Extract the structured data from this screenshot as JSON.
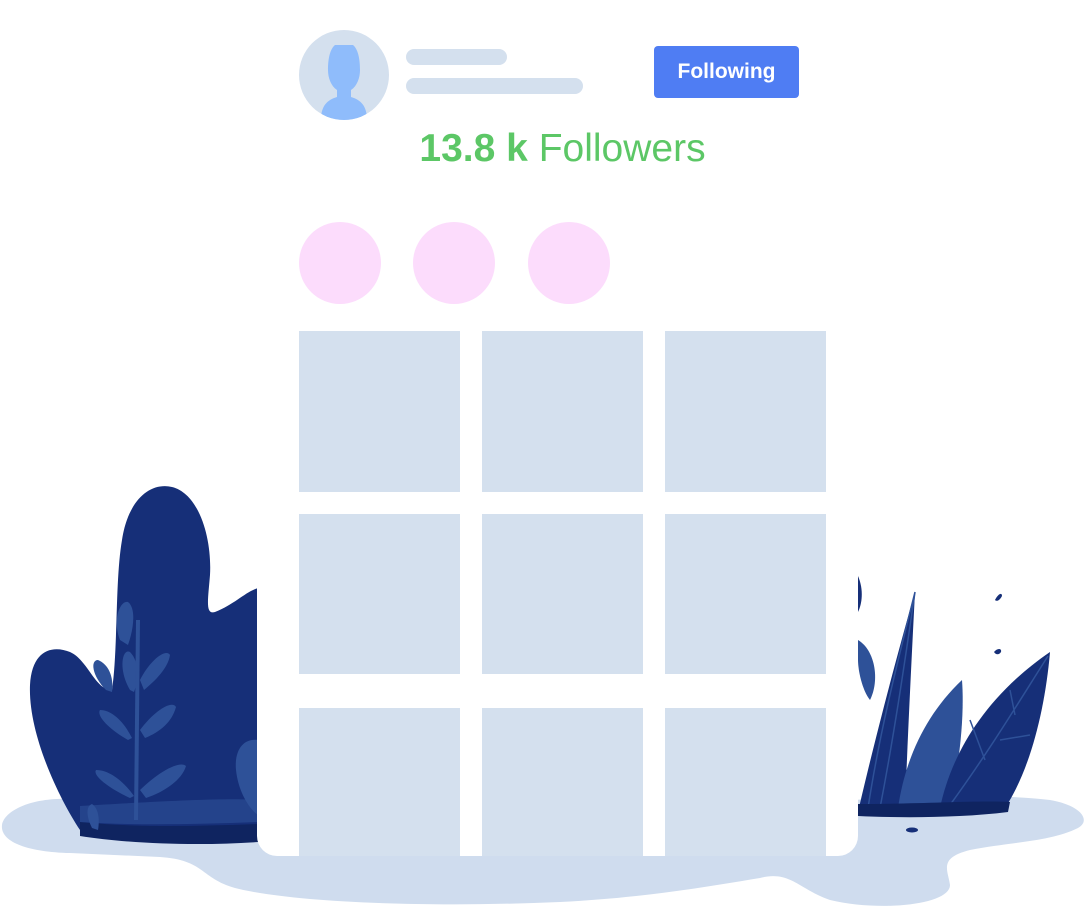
{
  "profile": {
    "button_label": "Following",
    "followers_count": "13.8 k",
    "followers_label": "Followers"
  },
  "story_highlights": [
    {},
    {},
    {}
  ],
  "post_grid": {
    "rows": 3,
    "columns": 3
  },
  "icons": {
    "avatar": "user-silhouette-icon"
  },
  "colors": {
    "accent": "#4f7df3",
    "followers_text": "#5cc766",
    "placeholder": "#d4e0ee",
    "highlight": "#fcdcfc",
    "foliage_dark": "#162f78",
    "foliage_light": "#2e5198",
    "ground": "#cfdcee"
  }
}
